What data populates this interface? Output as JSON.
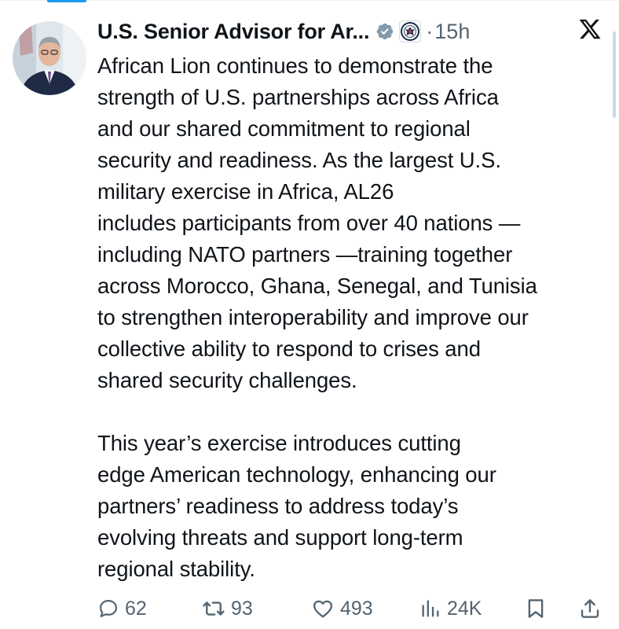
{
  "tweet": {
    "author_name": "U.S. Senior Advisor for Ar...",
    "separator": "·",
    "timestamp": "15h",
    "text": "African Lion continues to demonstrate the\nstrength of U.S. partnerships across Africa\nand our shared commitment to regional\nsecurity and readiness. As the largest U.S.\nmilitary exercise in Africa, AL26\nincludes participants from over 40 nations —\nincluding NATO partners —training together\nacross Morocco, Ghana, Senegal, and Tunisia\nto strengthen interoperability and improve our\ncollective ability to respond to crises and\nshared security challenges.\n\nThis year’s exercise introduces cutting\nedge American technology, enhancing our\npartners’ readiness to address today’s\nevolving threats and support long-term\nregional stability."
  },
  "icons": {
    "verified": "verified-badge-icon",
    "affiliate": "state-department-seal-icon",
    "platform": "x-logo-icon"
  },
  "actions": {
    "replies": "62",
    "reposts": "93",
    "likes": "493",
    "views": "24K"
  },
  "colors": {
    "text": "#0f1419",
    "secondary": "#536471",
    "accent": "#1d9bf0",
    "verified": "#829aab"
  }
}
